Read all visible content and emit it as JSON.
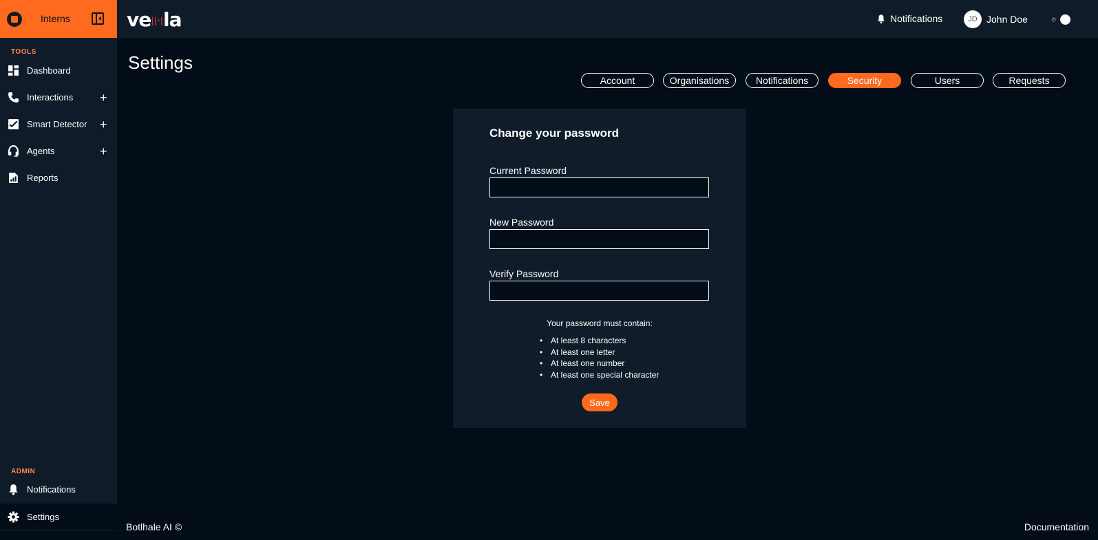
{
  "sidebar": {
    "brand": "Interns",
    "tools_label": "TOOLS",
    "tools": [
      {
        "label": "Dashboard",
        "icon": "dashboard-icon",
        "expandable": false
      },
      {
        "label": "Interactions",
        "icon": "phone-icon",
        "expandable": true
      },
      {
        "label": "Smart Detector",
        "icon": "chart-check-icon",
        "expandable": true
      },
      {
        "label": "Agents",
        "icon": "headset-icon",
        "expandable": true
      },
      {
        "label": "Reports",
        "icon": "report-icon",
        "expandable": false
      }
    ],
    "plus_glyph": "+",
    "admin_label": "ADMIN",
    "admin": [
      {
        "label": "Notifications",
        "icon": "bell-icon"
      },
      {
        "label": "Settings",
        "icon": "gear-icon",
        "active": true
      }
    ]
  },
  "topbar": {
    "logo_text_left": "ve",
    "logo_text_right": "la",
    "notifications_label": "Notifications",
    "user_initials": "JD",
    "user_name": "John Doe"
  },
  "page": {
    "title": "Settings",
    "tabs": [
      {
        "label": "Account"
      },
      {
        "label": "Organisations"
      },
      {
        "label": "Notifications"
      },
      {
        "label": "Security",
        "active": true
      },
      {
        "label": "Users"
      },
      {
        "label": "Requests"
      }
    ]
  },
  "card": {
    "title": "Change your password",
    "fields": [
      {
        "label": "Current Password",
        "value": ""
      },
      {
        "label": "New Password",
        "value": ""
      },
      {
        "label": "Verify Password",
        "value": ""
      }
    ],
    "requirements_title": "Your password must contain:",
    "requirements": [
      "At least 8 characters",
      "At least one letter",
      "At least one number",
      "At least one special character"
    ],
    "save_label": "Save"
  },
  "footer": {
    "left": "Botlhale AI ©",
    "right": "Documentation"
  },
  "colors": {
    "accent": "#ff6a1f",
    "background": "#020d17",
    "panel": "#0f1b29"
  }
}
